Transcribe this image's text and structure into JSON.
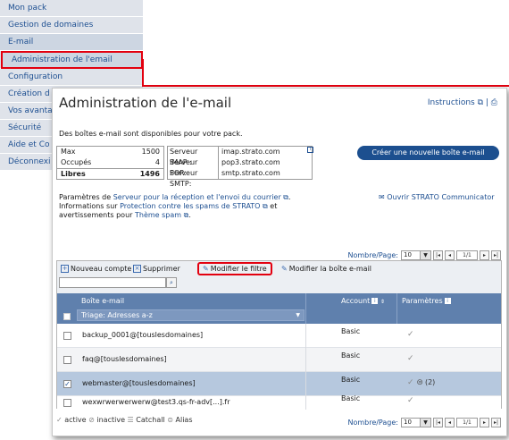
{
  "left_nav": {
    "items": [
      "Mon pack",
      "Gestion de domaines",
      "E-mail",
      "Configuration",
      "Création d",
      "Vos avanta",
      "Sécurité",
      "Aide et Co",
      "Déconnexi"
    ],
    "sub_item": "Administration de l'email"
  },
  "panel": {
    "title": "Administration de l'e-mail",
    "instructions": "Instructions",
    "intro": "Des boîtes e-mail sont disponibles pour votre pack.",
    "stats": [
      {
        "label": "Max",
        "value": "1500"
      },
      {
        "label": "Occupés",
        "value": "4"
      },
      {
        "label": "Libres",
        "value": "1496"
      }
    ],
    "servers": [
      {
        "label": "Serveur IMAP :",
        "value": "imap.strato.com"
      },
      {
        "label": "Serveur POP:",
        "value": "pop3.strato.com"
      },
      {
        "label": "Serveur SMTP:",
        "value": "smtp.strato.com"
      }
    ],
    "new_button": "Créer une nouvelle boîte e-mail",
    "params": {
      "p1_pre": "Paramètres de ",
      "p1_link": "Serveur pour la réception et l'envoi du courrier",
      "p2_pre": "Informations sur ",
      "p2_link": "Protection contre les spams de STRATO",
      "p2_post": " et",
      "p3_pre": "avertissements pour ",
      "p3_link": "Thème spam"
    },
    "communicator": "Ouvrir STRATO Communicator",
    "pager": {
      "label": "Nombre/Page:",
      "size": "10",
      "pages": "1/1"
    },
    "toolbar": {
      "new_account": "Nouveau compte",
      "delete": "Supprimer",
      "modify_filter": "Modifier le filtre",
      "modify_box": "Modifier la boîte e-mail"
    },
    "table": {
      "col_box": "Boîte e-mail",
      "sort": "Triage: Adresses a-z",
      "col_account": "Account",
      "col_params": "Paramètres",
      "rows": [
        {
          "email": "backup_0001@[touslesdomaines]",
          "account": "Basic",
          "extra": ""
        },
        {
          "email": "faq@[touslesdomaines]",
          "account": "Basic",
          "extra": ""
        },
        {
          "email": "webmaster@[touslesdomaines]",
          "account": "Basic",
          "extra": "(2)"
        },
        {
          "email": "wexwrwerwerwerw@test3.qs-fr-adv[...].fr",
          "account": "Basic",
          "extra": ""
        }
      ]
    },
    "legend": {
      "active": "active",
      "inactive": "inactive",
      "catchall": "Catchall",
      "alias": "Alias"
    }
  },
  "colors": {
    "accent": "#1c4f8f",
    "highlight": "#e3000f",
    "header": "#5f80ad"
  }
}
